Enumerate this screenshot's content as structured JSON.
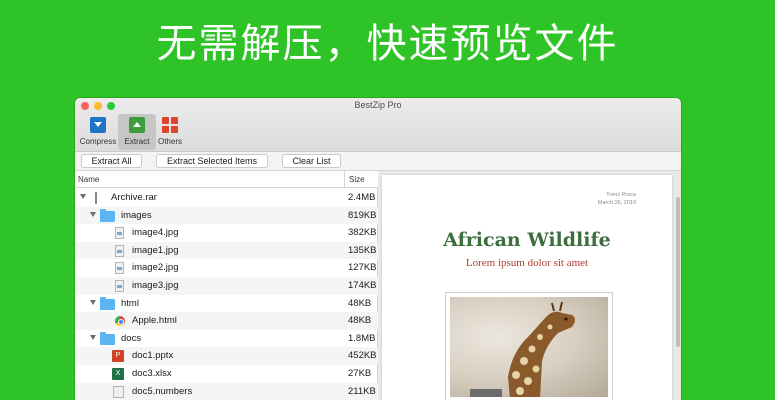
{
  "banner": {
    "headline": "无需解压，快速预览文件"
  },
  "window": {
    "title": "BestZip Pro"
  },
  "toolbar": {
    "compress_label": "Compress",
    "extract_label": "Extract",
    "others_label": "Others"
  },
  "buttons": {
    "extract_all": "Extract All",
    "extract_selected": "Extract Selected Items",
    "clear_list": "Clear List"
  },
  "filelist": {
    "columns": {
      "name": "Name",
      "size": "Size"
    },
    "rows": [
      {
        "name": "Archive.rar",
        "size": "2.4MB",
        "type": "archive"
      },
      {
        "name": "images",
        "size": "819KB",
        "type": "folder"
      },
      {
        "name": "image4.jpg",
        "size": "382KB",
        "type": "image"
      },
      {
        "name": "image1.jpg",
        "size": "135KB",
        "type": "image"
      },
      {
        "name": "image2.jpg",
        "size": "127KB",
        "type": "image"
      },
      {
        "name": "image3.jpg",
        "size": "174KB",
        "type": "image"
      },
      {
        "name": "html",
        "size": "48KB",
        "type": "folder"
      },
      {
        "name": "Apple.html",
        "size": "48KB",
        "type": "html"
      },
      {
        "name": "docs",
        "size": "1.8MB",
        "type": "folder"
      },
      {
        "name": "doc1.pptx",
        "size": "452KB",
        "type": "pptx"
      },
      {
        "name": "doc3.xlsx",
        "size": "27KB",
        "type": "xlsx"
      },
      {
        "name": "doc5.numbers",
        "size": "211KB",
        "type": "numbers"
      }
    ]
  },
  "preview": {
    "author": "Trenz Pruca",
    "date": "March 26, 2019",
    "title": "African Wildlife",
    "subtitle": "Lorem ipsum dolor sit amet",
    "photo_subject": "giraffe"
  },
  "colors": {
    "background": "#2ec326",
    "title_green": "#3c6d3c",
    "subtitle_red": "#b33d2b",
    "folder_blue": "#5bb5f3"
  }
}
